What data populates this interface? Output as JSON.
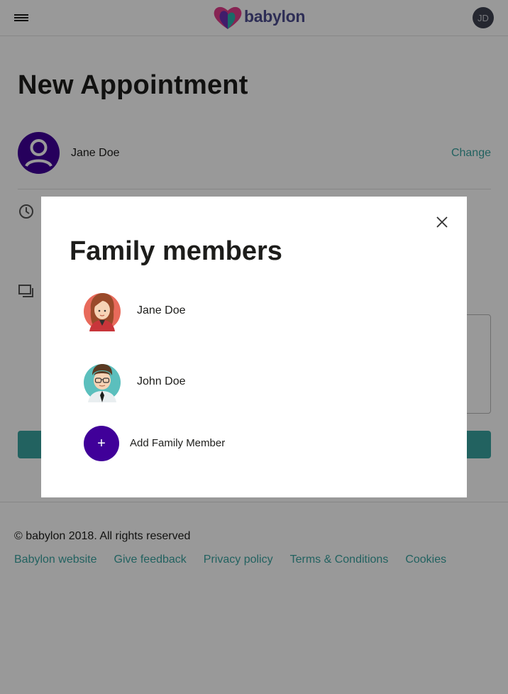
{
  "header": {
    "logo_text": "babylon",
    "user_initials": "JD"
  },
  "page": {
    "title": "New Appointment",
    "patient_name": "Jane Doe",
    "change_label": "Change"
  },
  "modal": {
    "title": "Family members",
    "members": [
      {
        "name": "Jane Doe"
      },
      {
        "name": "John Doe"
      }
    ],
    "add_label": "Add Family Member",
    "add_icon": "+"
  },
  "footer": {
    "copyright": "© babylon 2018. All rights reserved",
    "links": [
      "Babylon website",
      "Give feedback",
      "Privacy policy",
      "Terms & Conditions",
      "Cookies"
    ]
  },
  "colors": {
    "accent": "#3aa3a1",
    "brand_purple": "#400099",
    "overlay": "rgba(0,0,0,0.4)"
  }
}
